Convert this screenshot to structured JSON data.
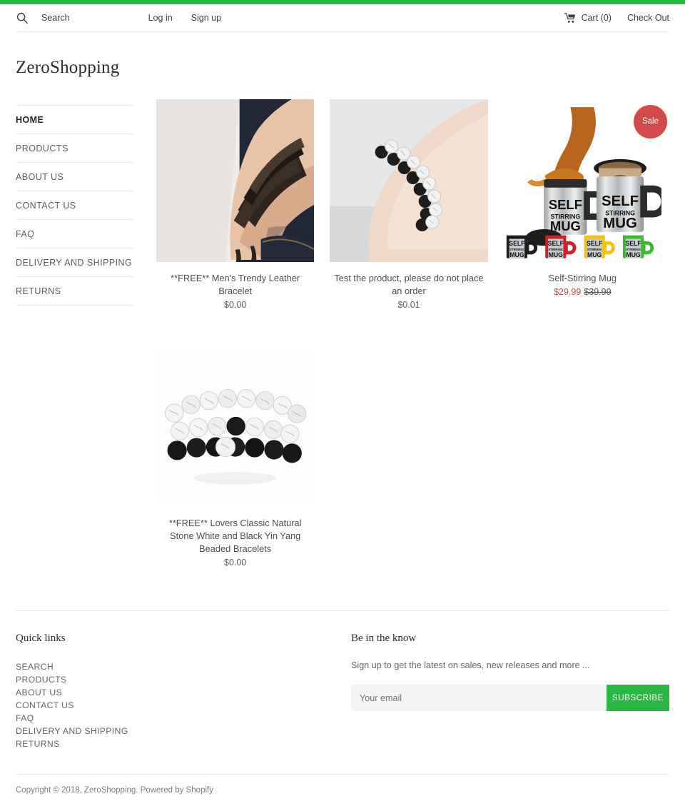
{
  "theme": {
    "accent_green": "#2cb742",
    "sale_red": "#d24b4b",
    "price_red": "#c0504d"
  },
  "header": {
    "search_icon": "search-icon",
    "search_label": "Search",
    "login_label": "Log in",
    "signup_label": "Sign up",
    "cart_icon": "shopping-cart-icon",
    "cart_label": "Cart (0)",
    "checkout_label": "Check Out"
  },
  "brand": {
    "name": "ZeroShopping"
  },
  "sidebar": {
    "items": [
      {
        "label": "HOME",
        "active": true
      },
      {
        "label": "PRODUCTS",
        "active": false
      },
      {
        "label": "ABOUT US",
        "active": false
      },
      {
        "label": "CONTACT US",
        "active": false
      },
      {
        "label": "FAQ",
        "active": false
      },
      {
        "label": "DELIVERY AND SHIPPING",
        "active": false
      },
      {
        "label": "RETURNS",
        "active": false
      }
    ]
  },
  "products": [
    {
      "title": "**FREE** Men's Trendy Leather Bracelet",
      "price": "$0.00",
      "image": "leather-bracelet-on-wrist",
      "on_sale": false
    },
    {
      "title": "Test the product, please do not place an order",
      "price": "$0.01",
      "image": "beaded-bracelets-on-wrist",
      "on_sale": false
    },
    {
      "title": "Self-Stirring Mug",
      "price": "$29.99",
      "compare_price": "$39.99",
      "image": "self-stirring-mugs",
      "on_sale": true,
      "sale_badge": "Sale"
    },
    {
      "title": "**FREE** Lovers Classic Natural Stone White and Black Yin Yang Beaded Bracelets",
      "price": "$0.00",
      "image": "black-white-beaded-bracelets",
      "on_sale": false
    }
  ],
  "footer": {
    "quick_links_heading": "Quick links",
    "quick_links": [
      {
        "label": "SEARCH"
      },
      {
        "label": "PRODUCTS"
      },
      {
        "label": "ABOUT US"
      },
      {
        "label": "CONTACT US"
      },
      {
        "label": "FAQ"
      },
      {
        "label": "DELIVERY AND SHIPPING"
      },
      {
        "label": "RETURNS"
      }
    ],
    "newsletter_heading": "Be in the know",
    "newsletter_text": "Sign up to get the latest on sales, new releases and more ...",
    "email_placeholder": "Your email",
    "email_value": "",
    "subscribe_label": "SUBSCRIBE",
    "copyright": "Copyright © 2018, ZeroShopping. Powered by Shopify"
  }
}
